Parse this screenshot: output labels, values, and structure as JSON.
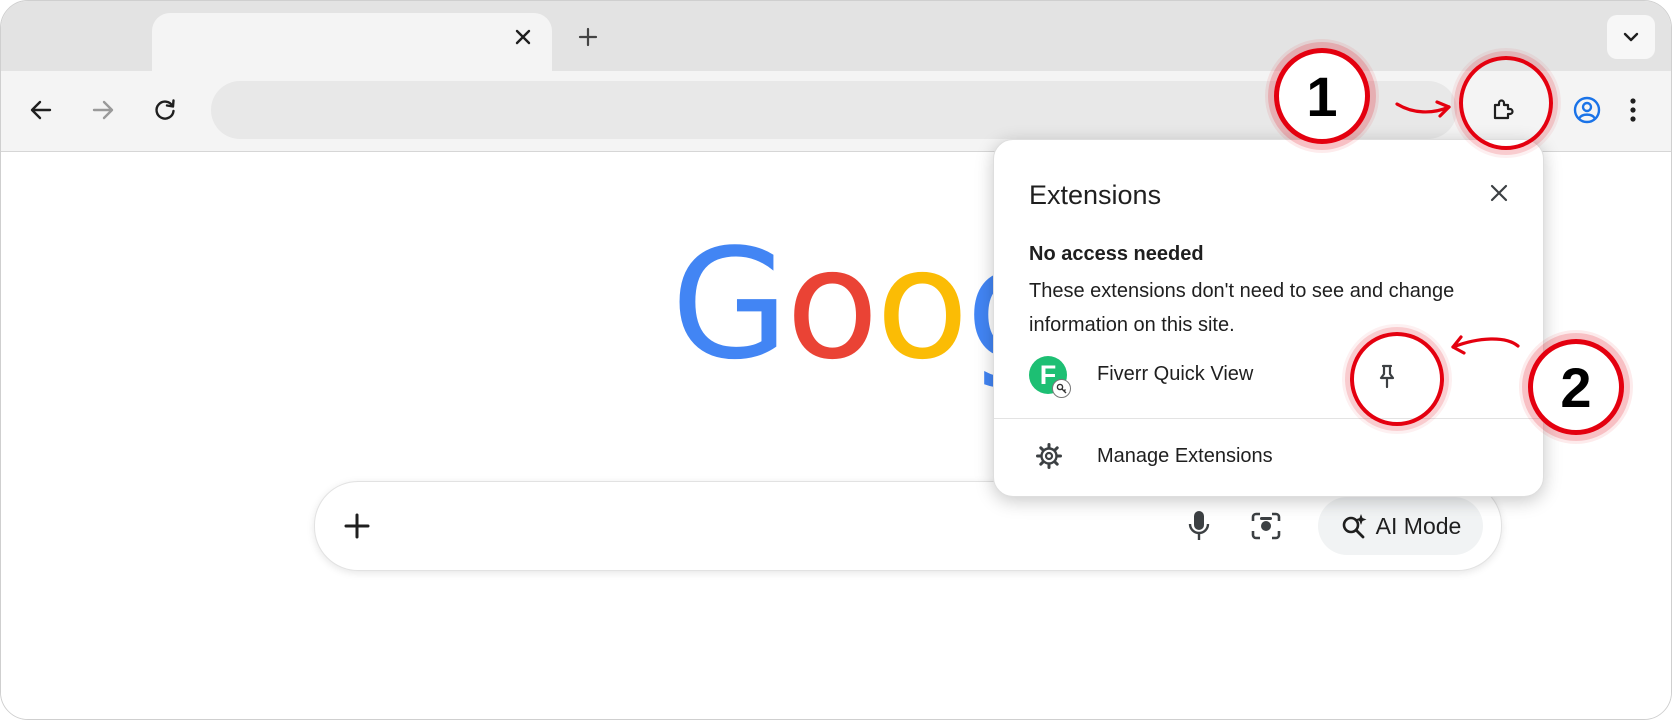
{
  "browser": {
    "active_tab_title": "",
    "omnibox_value": ""
  },
  "logo": {
    "letters": [
      "G",
      "o",
      "o",
      "g"
    ],
    "colors": [
      "#4285F4",
      "#EA4335",
      "#FBBC05",
      "#4285F4"
    ]
  },
  "searchbar": {
    "ai_mode_label": "AI Mode"
  },
  "extensions_popup": {
    "title": "Extensions",
    "section_heading": "No access needed",
    "description": "These extensions don't need to see and change information on this site.",
    "items": [
      {
        "name": "Fiverr Quick View",
        "icon_letter": "F",
        "icon_color": "#1DBF73"
      }
    ],
    "manage_label": "Manage Extensions"
  },
  "annotations": {
    "step1": "1",
    "step2": "2",
    "accent": "#E4000F"
  },
  "colors": {
    "tabstrip": "#E3E3E3",
    "toolbar": "#F4F4F4",
    "profile_blue": "#1A73E8"
  }
}
